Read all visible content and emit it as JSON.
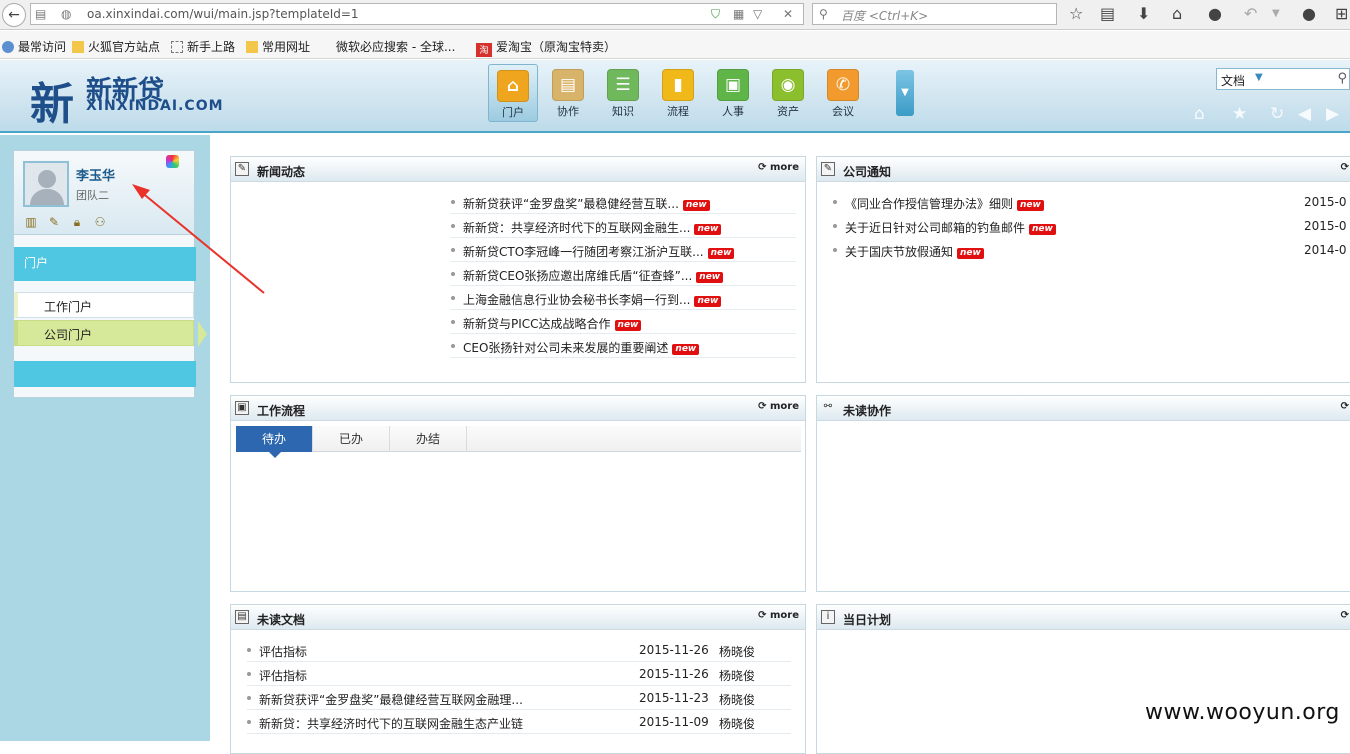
{
  "browser": {
    "url": "oa.xinxindai.com/wui/main.jsp?templateId=1",
    "search_placeholder": "百度 <Ctrl+K>"
  },
  "bookmarks": [
    {
      "label": "最常访问"
    },
    {
      "label": "火狐官方站点"
    },
    {
      "label": "新手上路"
    },
    {
      "label": "常用网址"
    },
    {
      "label": "微软必应搜索 - 全球..."
    },
    {
      "label": "爱淘宝（原淘宝特卖）"
    }
  ],
  "header": {
    "logo_mark": "新",
    "logo_name": "新新贷",
    "logo_sub": "XINXINDAI.COM",
    "nav": [
      {
        "label": "门户",
        "color": "#f0a51e",
        "icon": "home-icon",
        "glyph": "⌂"
      },
      {
        "label": "协作",
        "color": "#d8b46a",
        "icon": "clipboard-icon",
        "glyph": "▤"
      },
      {
        "label": "知识",
        "color": "#6fb85c",
        "icon": "knowledge-icon",
        "glyph": "☰"
      },
      {
        "label": "流程",
        "color": "#f0b818",
        "icon": "chart-icon",
        "glyph": "▮"
      },
      {
        "label": "人事",
        "color": "#5fb548",
        "icon": "id-card-icon",
        "glyph": "▣"
      },
      {
        "label": "资产",
        "color": "#8cbf2e",
        "icon": "coins-icon",
        "glyph": "◉"
      },
      {
        "label": "会议",
        "color": "#f29a2e",
        "icon": "phone-icon",
        "glyph": "✆"
      }
    ],
    "doc_search_type": "文档"
  },
  "user": {
    "name": "李玉华",
    "team": "团队二"
  },
  "menu": {
    "head": "门户",
    "items": [
      {
        "label": "工作门户"
      },
      {
        "label": "公司门户"
      }
    ]
  },
  "panels": {
    "news": {
      "title": "新闻动态",
      "more": "more",
      "items": [
        {
          "text": "新新贷获评“金罗盘奖”最稳健经营互联..."
        },
        {
          "text": "新新贷：共享经济时代下的互联网金融生..."
        },
        {
          "text": "新新贷CTO李冠峰一行随团考察江浙沪互联..."
        },
        {
          "text": "新新贷CEO张扬应邀出席维氏盾“征查蜂”..."
        },
        {
          "text": "上海金融信息行业协会秘书长李娟一行到..."
        },
        {
          "text": "新新贷与PICC达成战略合作"
        },
        {
          "text": "CEO张扬针对公司未来发展的重要阐述"
        }
      ],
      "new_label": "new"
    },
    "notice": {
      "title": "公司通知",
      "items": [
        {
          "text": "《同业合作授信管理办法》细则",
          "date": "2015-0"
        },
        {
          "text": "关于近日针对公司邮箱的钓鱼邮件",
          "date": "2015-0"
        },
        {
          "text": "关于国庆节放假通知",
          "date": "2014-0"
        }
      ]
    },
    "workflow": {
      "title": "工作流程",
      "more": "more",
      "tabs": [
        {
          "label": "待办"
        },
        {
          "label": "已办"
        },
        {
          "label": "办结"
        }
      ]
    },
    "unread_collab": {
      "title": "未读协作"
    },
    "unread_docs": {
      "title": "未读文档",
      "more": "more",
      "items": [
        {
          "text": "评估指标",
          "date": "2015-11-26",
          "person": "杨晓俊"
        },
        {
          "text": "评估指标",
          "date": "2015-11-26",
          "person": "杨晓俊"
        },
        {
          "text": "新新贷获评“金罗盘奖”最稳健经营互联网金融理...",
          "date": "2015-11-23",
          "person": "杨晓俊"
        },
        {
          "text": "新新贷：共享经济时代下的互联网金融生态产业链",
          "date": "2015-11-09",
          "person": "杨晓俊"
        }
      ]
    },
    "daily_plan": {
      "title": "当日计划"
    }
  },
  "watermark": "www.wooyun.org"
}
